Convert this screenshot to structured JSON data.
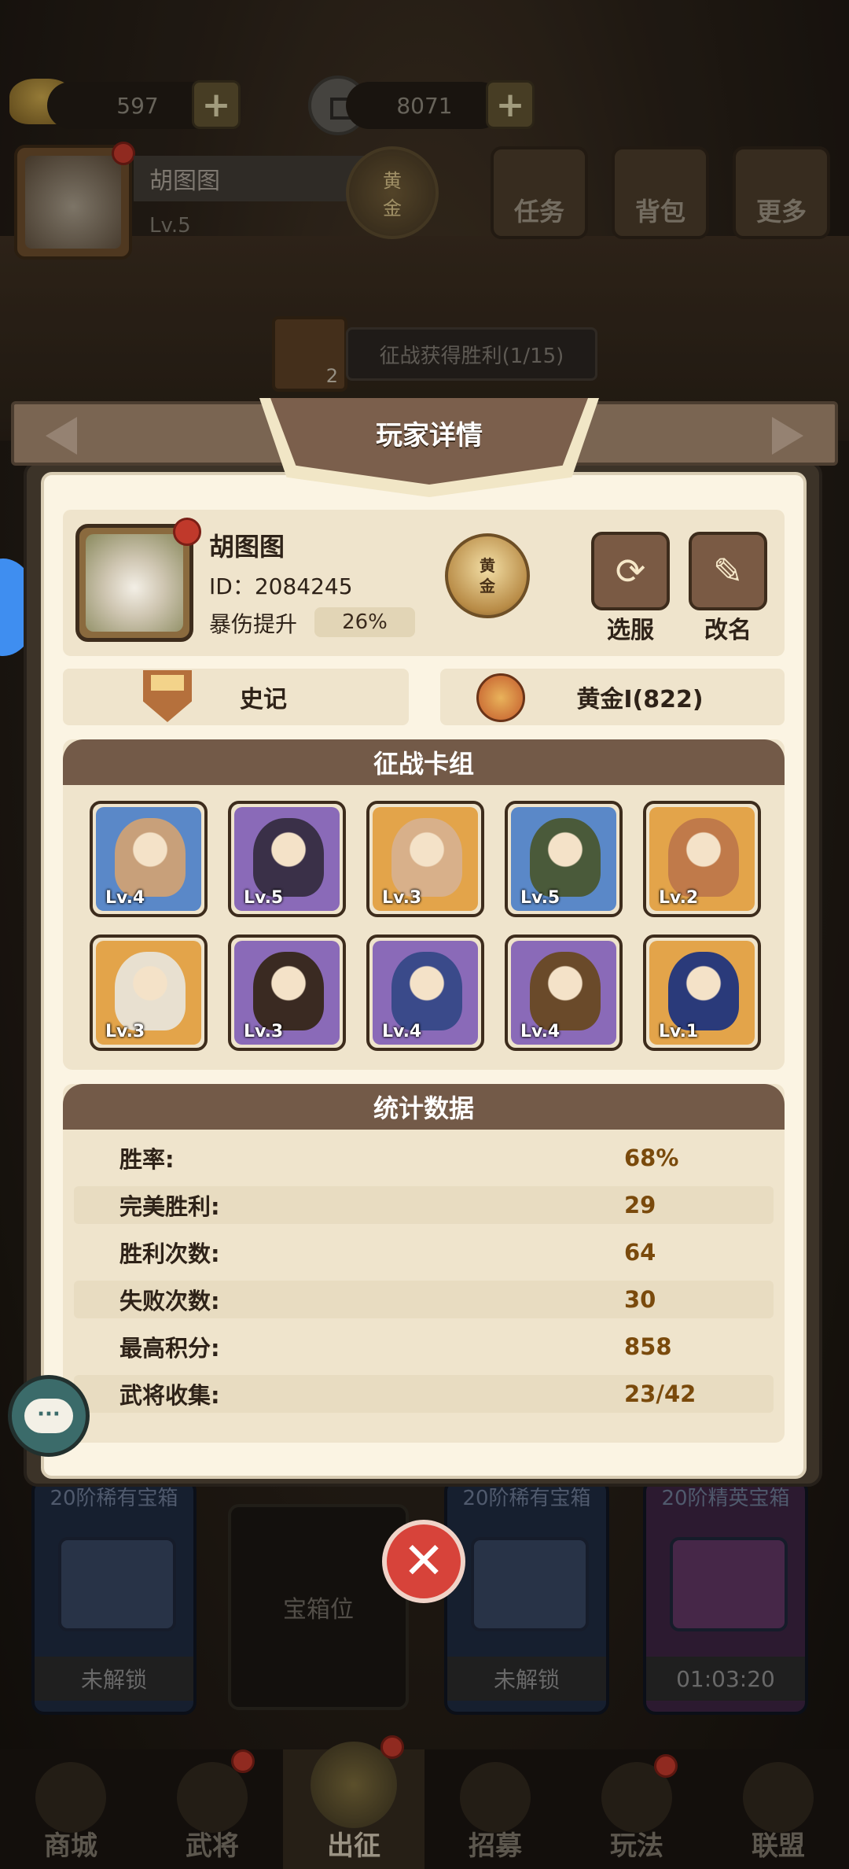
{
  "top": {
    "ingot": "597",
    "coins": "8071",
    "player_name": "胡图图",
    "level": "Lv.5",
    "rank_badge": [
      "黄",
      "金"
    ],
    "buttons": [
      "任务",
      "背包",
      "更多"
    ],
    "quest_count": "2",
    "quest_text": "征战获得胜利(1/15)"
  },
  "modal": {
    "title": "玩家详情",
    "name": "胡图图",
    "id": "ID：2084245",
    "crit_label": "暴伤提升",
    "crit_value": "26%",
    "rank_badge": [
      "黄",
      "金"
    ],
    "select_server": "选服",
    "rename": "改名",
    "history": "史记",
    "rank": "黄金Ⅰ(822)",
    "deck_title": "征战卡组",
    "heroes": [
      {
        "lv": "Lv.4",
        "frame": "blue"
      },
      {
        "lv": "Lv.5",
        "frame": "purple"
      },
      {
        "lv": "Lv.3",
        "frame": "gold"
      },
      {
        "lv": "Lv.5",
        "frame": "blue"
      },
      {
        "lv": "Lv.2",
        "frame": "gold"
      },
      {
        "lv": "Lv.3",
        "frame": "gold"
      },
      {
        "lv": "Lv.3",
        "frame": "purple"
      },
      {
        "lv": "Lv.4",
        "frame": "purple"
      },
      {
        "lv": "Lv.4",
        "frame": "purple"
      },
      {
        "lv": "Lv.1",
        "frame": "gold"
      }
    ],
    "stats_title": "统计数据",
    "stats": [
      {
        "k": "胜率:",
        "v": "68%"
      },
      {
        "k": "完美胜利:",
        "v": "29"
      },
      {
        "k": "胜利次数:",
        "v": "64"
      },
      {
        "k": "失败次数:",
        "v": "30"
      },
      {
        "k": "最高积分:",
        "v": "858"
      },
      {
        "k": "武将收集:",
        "v": "23/42"
      }
    ]
  },
  "chests": {
    "left_top": "20阶稀有宝箱",
    "left_label": "未解锁",
    "slot": "宝箱位",
    "mid_top": "20阶稀有宝箱",
    "mid_label": "未解锁",
    "right_top": "20阶精英宝箱",
    "right_label": "01:03:20"
  },
  "nav": [
    "商城",
    "武将",
    "出征",
    "招募",
    "玩法",
    "联盟"
  ],
  "icons": {
    "refresh": "refresh-icon",
    "pencil": "pencil-icon",
    "chat": "chat-icon",
    "close": "close-icon"
  },
  "colors": {
    "header": "#735a48",
    "panel": "#fbf4e3",
    "close": "#d7433a"
  }
}
